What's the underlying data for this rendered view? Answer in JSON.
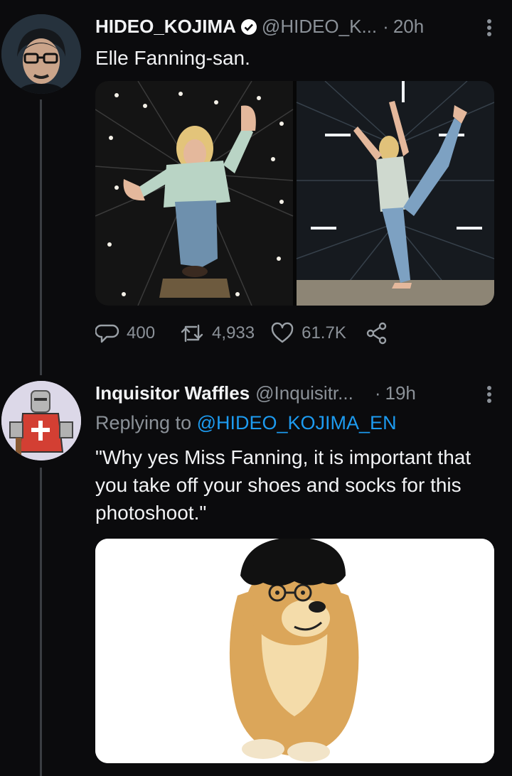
{
  "tweet1": {
    "name": "HIDEO_KOJIMA",
    "handle": "@HIDEO_K...",
    "dot": "·",
    "time": "20h",
    "text": "Elle Fanning-san.",
    "actions": {
      "replies": "400",
      "retweets": "4,933",
      "likes": "61.7K"
    }
  },
  "tweet2": {
    "name": "Inquisitor Waffles",
    "handle": "@Inquisitr...",
    "dot": "·",
    "time": "19h",
    "replying_prefix": "Replying to ",
    "replying_handle": "@HIDEO_KOJIMA_EN",
    "text": "\"Why yes Miss Fanning, it is important that you take off your shoes and socks for this photoshoot.\""
  },
  "colors": {
    "background": "#0b0b0d",
    "link": "#1d9bf0",
    "muted": "#8b9198",
    "verified": "#ffffff"
  },
  "icons": [
    "verified-icon",
    "more-icon",
    "reply-icon",
    "retweet-icon",
    "like-icon",
    "share-icon"
  ]
}
